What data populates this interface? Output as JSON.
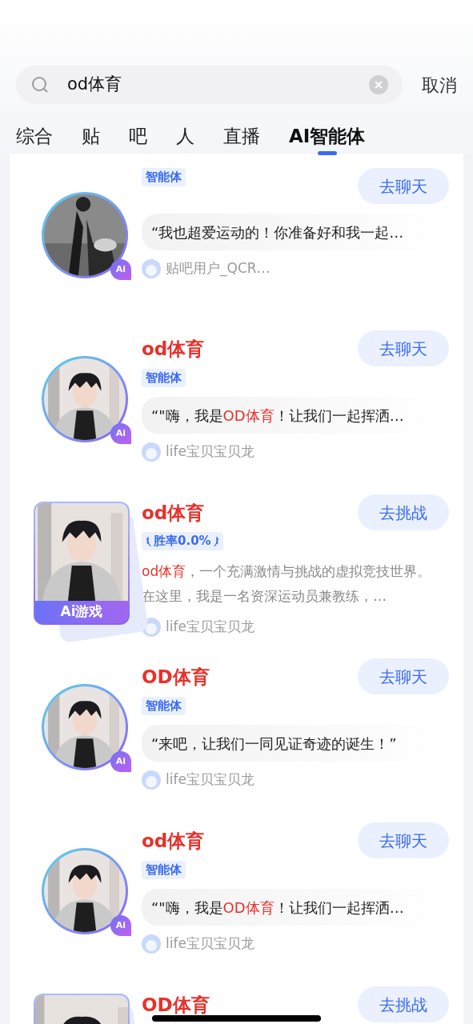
{
  "search": {
    "value": "od体育",
    "cancel": "取消"
  },
  "tabs": [
    {
      "label": "综合",
      "selected": false
    },
    {
      "label": "贴",
      "selected": false
    },
    {
      "label": "吧",
      "selected": false
    },
    {
      "label": "人",
      "selected": false
    },
    {
      "label": "直播",
      "selected": false
    },
    {
      "label": "AI智能体",
      "selected": true
    }
  ],
  "results": [
    {
      "kind": "agent",
      "badge": "Ai",
      "tag": "智能体",
      "text": [
        {
          "text": "“我也超爱运动的！你准备好和我一起…",
          "highlight": false
        }
      ],
      "author": "贴吧用户_QCR…",
      "button": "去聊天"
    },
    {
      "kind": "agent",
      "title": "od体育",
      "badge": "Ai",
      "tag": "智能体",
      "text": [
        {
          "text": "“\"嗨，我是",
          "highlight": false
        },
        {
          "text": "OD体育",
          "highlight": true
        },
        {
          "text": "！让我们一起挥洒…",
          "highlight": false
        }
      ],
      "author": "life宝贝宝贝龙",
      "button": "去聊天"
    },
    {
      "kind": "game",
      "title": "od体育",
      "badge": "Ai游戏",
      "tag": "胜率0.0%",
      "text": [
        {
          "text": "od体育",
          "highlight": true
        },
        {
          "text": "，一个充满激情与挑战的虚拟竞技世界。在这里，我是一名资深运动员兼教练，…",
          "highlight": false
        }
      ],
      "author": "life宝贝宝贝龙",
      "button": "去挑战"
    },
    {
      "kind": "agent",
      "title": "OD体育",
      "badge": "Ai",
      "tag": "智能体",
      "text": [
        {
          "text": "“来吧，让我们一同见证奇迹的诞生！”",
          "highlight": false
        }
      ],
      "author": "life宝贝宝贝龙",
      "button": "去聊天"
    },
    {
      "kind": "agent",
      "title": "od体育",
      "badge": "Ai",
      "tag": "智能体",
      "text": [
        {
          "text": "“\"嗨，我是",
          "highlight": false
        },
        {
          "text": "OD体育",
          "highlight": true
        },
        {
          "text": "！让我们一起挥洒…",
          "highlight": false
        }
      ],
      "author": "life宝贝宝贝龙",
      "button": "去聊天"
    },
    {
      "kind": "game",
      "title": "OD体育",
      "button": "去挑战"
    }
  ]
}
